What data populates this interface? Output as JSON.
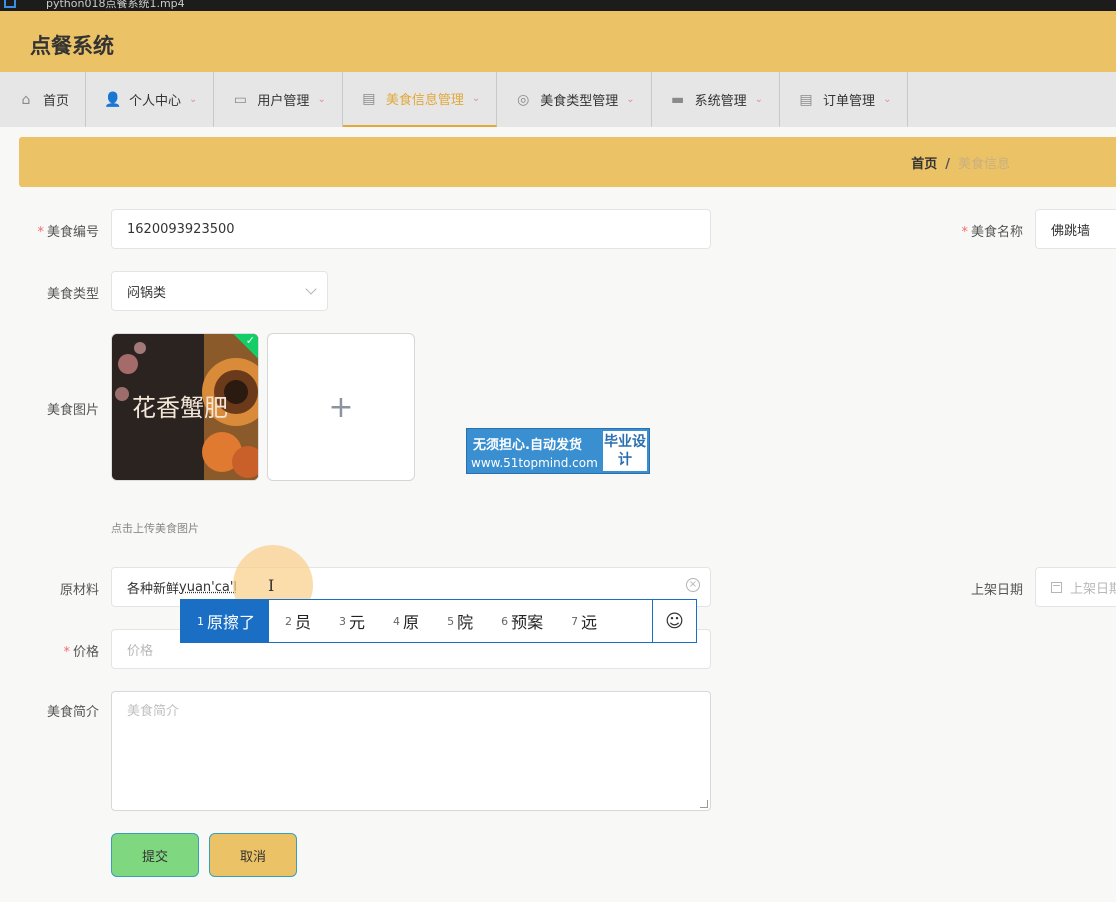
{
  "window": {
    "title": "python018点餐系统1.mp4"
  },
  "header": {
    "app_title": "点餐系统"
  },
  "nav": {
    "items": [
      {
        "label": "首页",
        "icon": "home-icon",
        "glyph": "⌂",
        "has_dropdown": false
      },
      {
        "label": "个人中心",
        "icon": "user-icon",
        "glyph": "👤",
        "has_dropdown": true
      },
      {
        "label": "用户管理",
        "icon": "chat-icon",
        "glyph": "▭",
        "has_dropdown": true
      },
      {
        "label": "美食信息管理",
        "icon": "clipboard-icon",
        "glyph": "▤",
        "has_dropdown": true,
        "active": true
      },
      {
        "label": "美食类型管理",
        "icon": "compass-icon",
        "glyph": "◎",
        "has_dropdown": true
      },
      {
        "label": "系统管理",
        "icon": "message-icon",
        "glyph": "▬",
        "has_dropdown": true
      },
      {
        "label": "订单管理",
        "icon": "document-icon",
        "glyph": "▤",
        "has_dropdown": true
      }
    ],
    "chevron": "⌄",
    "active_color": "#e2a83a"
  },
  "breadcrumb": {
    "home": "首页",
    "separator": "/",
    "current": "美食信息"
  },
  "form": {
    "food_code": {
      "label": "美食编号",
      "value": "1620093923500",
      "required": true
    },
    "food_name": {
      "label": "美食名称",
      "value": "佛跳墙",
      "required": true
    },
    "food_type": {
      "label": "美食类型",
      "value": "闷锅类"
    },
    "food_image": {
      "label": "美食图片",
      "upload_plus": "+",
      "tip": "点击上传美食图片",
      "image_text": "花香蟹肥"
    },
    "ingredients": {
      "label": "原材料",
      "value": "各种新鲜",
      "composing": "yuan'ca'l"
    },
    "listing_date": {
      "label": "上架日期",
      "placeholder": "上架日期"
    },
    "price": {
      "label": "价格",
      "placeholder": "价格",
      "required": true
    },
    "intro": {
      "label": "美食简介",
      "placeholder": "美食简介"
    },
    "submit_label": "提交",
    "cancel_label": "取消"
  },
  "ime": {
    "candidates": [
      {
        "num": "1",
        "text": "原擦了",
        "selected": true
      },
      {
        "num": "2",
        "text": "员"
      },
      {
        "num": "3",
        "text": "元"
      },
      {
        "num": "4",
        "text": "原"
      },
      {
        "num": "5",
        "text": "院"
      },
      {
        "num": "6",
        "text": "预案"
      },
      {
        "num": "7",
        "text": "远"
      }
    ],
    "emoji": "☺"
  },
  "watermark": {
    "line1": "无须担心.自动发货",
    "line2": "www.51topmind.com",
    "badge": "毕业设计"
  },
  "colors": {
    "header_bg": "#ebc266",
    "required": "#f56c6c",
    "submit_bg": "#7fd87f",
    "ime_selected": "#1a6fc4"
  }
}
